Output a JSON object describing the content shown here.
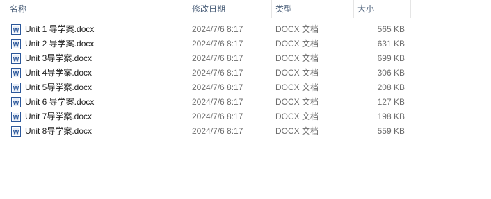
{
  "columns": {
    "name": "名称",
    "date": "修改日期",
    "type": "类型",
    "size": "大小"
  },
  "files": [
    {
      "name": "Unit 1 导学案.docx",
      "date": "2024/7/6 8:17",
      "type": "DOCX 文档",
      "size": "565 KB",
      "icon": "word-document-icon"
    },
    {
      "name": "Unit 2 导学案.docx",
      "date": "2024/7/6 8:17",
      "type": "DOCX 文档",
      "size": "631 KB",
      "icon": "word-document-icon"
    },
    {
      "name": "Unit 3导学案.docx",
      "date": "2024/7/6 8:17",
      "type": "DOCX 文档",
      "size": "699 KB",
      "icon": "word-document-icon"
    },
    {
      "name": "Unit 4导学案.docx",
      "date": "2024/7/6 8:17",
      "type": "DOCX 文档",
      "size": "306 KB",
      "icon": "word-document-icon"
    },
    {
      "name": "Unit 5导学案.docx",
      "date": "2024/7/6 8:17",
      "type": "DOCX 文档",
      "size": "208 KB",
      "icon": "word-document-icon"
    },
    {
      "name": "Unit 6 导学案.docx",
      "date": "2024/7/6 8:17",
      "type": "DOCX 文档",
      "size": "127 KB",
      "icon": "word-document-icon"
    },
    {
      "name": "Unit 7导学案.docx",
      "date": "2024/7/6 8:17",
      "type": "DOCX 文档",
      "size": "198 KB",
      "icon": "word-document-icon"
    },
    {
      "name": "Unit 8导学案.docx",
      "date": "2024/7/6 8:17",
      "type": "DOCX 文档",
      "size": "559 KB",
      "icon": "word-document-icon"
    }
  ],
  "colors": {
    "header_text": "#4c607a",
    "name_text": "#1e1e1e",
    "detail_text": "#6d6d6d",
    "icon_blue": "#2b579a"
  }
}
